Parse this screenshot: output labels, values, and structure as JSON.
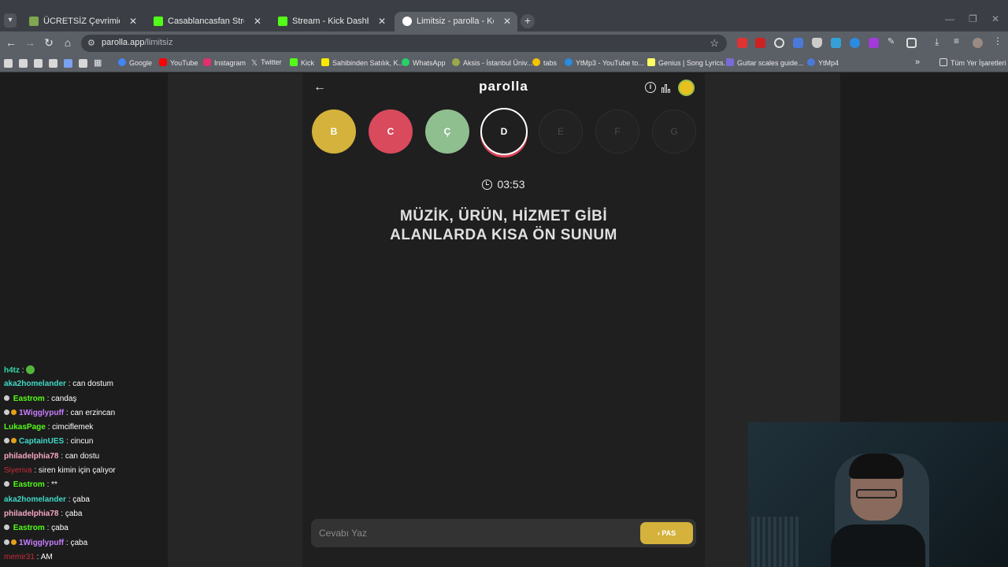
{
  "browser": {
    "tabs": [
      {
        "title": "ÜCRETSİZ Çevrimiçi Satranç Oyu",
        "favicon_color": "#7fa650",
        "active": false
      },
      {
        "title": "Casablancasfan Stream - Watch",
        "favicon_color": "#53fc18",
        "active": false
      },
      {
        "title": "Stream - Kick Dashboard",
        "favicon_color": "#53fc18",
        "active": false
      },
      {
        "title": "Limitsiz - parolla - Kelime oyunu",
        "favicon_color": "#ffffff",
        "active": true
      }
    ],
    "url_host": "parolla.app",
    "url_path": "/limitsiz",
    "bookmarks": [
      {
        "label": "Google",
        "color": "#4285f4"
      },
      {
        "label": "YouTube",
        "color": "#ff0000"
      },
      {
        "label": "Instagram",
        "color": "#e1306c"
      },
      {
        "label": "Twitter",
        "color": "#dddddd"
      },
      {
        "label": "Kick",
        "color": "#53fc18"
      },
      {
        "label": "Sahibinden Satılık, K...",
        "color": "#ffe800"
      },
      {
        "label": "WhatsApp",
        "color": "#25d366"
      },
      {
        "label": "Aksis - İstanbul Üniv...",
        "color": "#9aa74a"
      },
      {
        "label": "tabs",
        "color": "#f5c400"
      },
      {
        "label": "YtMp3 - YouTube to...",
        "color": "#2a8be0"
      },
      {
        "label": "Genius | Song Lyrics...",
        "color": "#ffff64"
      },
      {
        "label": "Guitar scales guide...",
        "color": "#7a6ad8"
      },
      {
        "label": "YtMp4",
        "color": "#4a7ad8"
      }
    ],
    "all_bookmarks_label": "Tüm Yer İşaretleri"
  },
  "app": {
    "title": "parolla",
    "letters": [
      {
        "letter": "B",
        "state": "done-y"
      },
      {
        "letter": "C",
        "state": "done-r"
      },
      {
        "letter": "Ç",
        "state": "done-g"
      },
      {
        "letter": "D",
        "state": "cur"
      },
      {
        "letter": "E",
        "state": "todo"
      },
      {
        "letter": "F",
        "state": "todo"
      },
      {
        "letter": "G",
        "state": "todo"
      }
    ],
    "timer": "03:53",
    "question": "MÜZİK, ÜRÜN, HİZMET GİBİ ALANLARDA KISA ÖN SUNUM",
    "answer_placeholder": "Cevabı Yaz",
    "pass_label": "PAS",
    "colors": {
      "yellow": "#d4b23c",
      "red": "#d94a5c",
      "green": "#8fbe8f"
    }
  },
  "chat": [
    {
      "user": "h4tz",
      "color": "#2ed8a5",
      "badges": [],
      "message": "",
      "emote": "green-blob-emote"
    },
    {
      "user": "aka2homelander",
      "color": "#3fd8c8",
      "badges": [],
      "message": "can dostum"
    },
    {
      "user": "Eastrom",
      "color": "#53fc18",
      "badges": [
        "sub"
      ],
      "message": "candaş"
    },
    {
      "user": "1Wigglypuff",
      "color": "#c77dff",
      "badges": [
        "sub",
        "gift"
      ],
      "message": "can erzincan"
    },
    {
      "user": "LukasPage",
      "color": "#53fc18",
      "badges": [],
      "message": "cimciflemek"
    },
    {
      "user": "CaptainUES",
      "color": "#3fd8c8",
      "badges": [
        "sub",
        "gift"
      ],
      "message": "cincun"
    },
    {
      "user": "philadelphia78",
      "color": "#f4a6c4",
      "badges": [],
      "message": "can dostu"
    },
    {
      "user": "Siyenva",
      "color": "#c92a3a",
      "badges": [],
      "message": "siren kimin için çalıyor"
    },
    {
      "user": "Eastrom",
      "color": "#53fc18",
      "badges": [
        "sub"
      ],
      "message": "**"
    },
    {
      "user": "aka2homelander",
      "color": "#3fd8c8",
      "badges": [],
      "message": "çaba"
    },
    {
      "user": "philadelphia78",
      "color": "#f4a6c4",
      "badges": [],
      "message": "çaba"
    },
    {
      "user": "Eastrom",
      "color": "#53fc18",
      "badges": [
        "sub"
      ],
      "message": "çaba"
    },
    {
      "user": "1Wigglypuff",
      "color": "#c77dff",
      "badges": [
        "sub",
        "gift"
      ],
      "message": "çaba"
    },
    {
      "user": "memir31",
      "color": "#c92a3a",
      "badges": [],
      "message": "AM"
    }
  ]
}
